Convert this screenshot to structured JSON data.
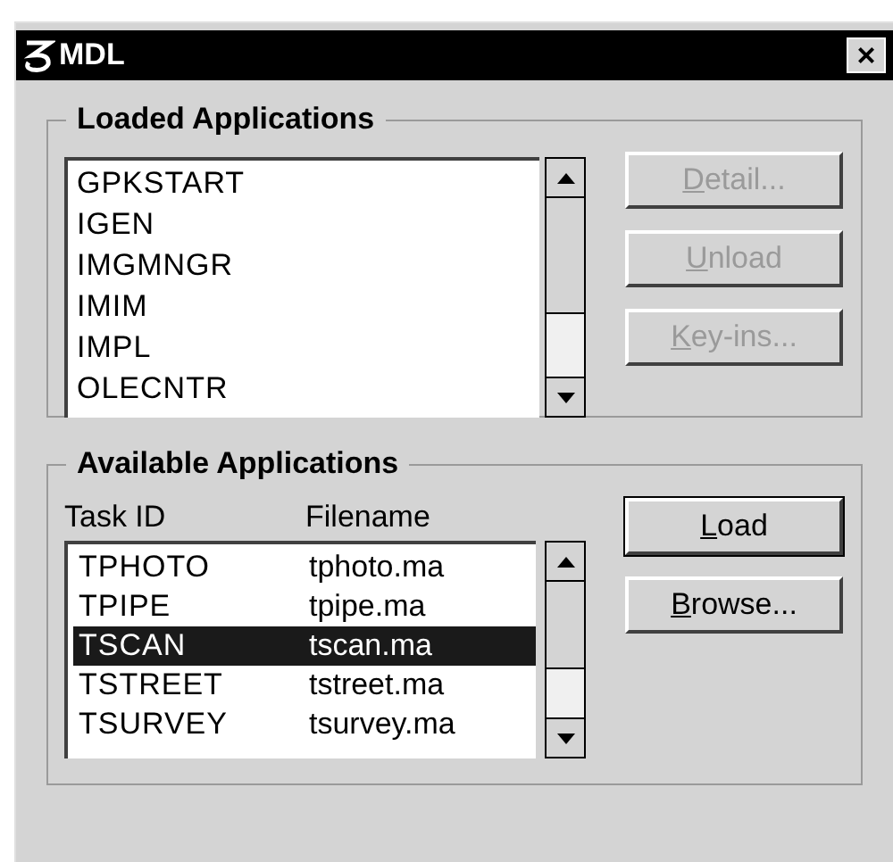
{
  "window": {
    "title": "MDL",
    "close": "×"
  },
  "loaded": {
    "title": "Loaded Applications",
    "items": [
      {
        "label": "GPKSTART",
        "selected": false
      },
      {
        "label": "IGEN",
        "selected": false
      },
      {
        "label": "IMGMNGR",
        "selected": false
      },
      {
        "label": "IMIM",
        "selected": false
      },
      {
        "label": "IMPL",
        "selected": false
      },
      {
        "label": "OLECNTR",
        "selected": false
      }
    ],
    "buttons": [
      {
        "label": "Detail...",
        "disabled": true,
        "default": false
      },
      {
        "label": "Unload",
        "disabled": true,
        "default": false
      },
      {
        "label": "Key-ins...",
        "disabled": true,
        "default": false
      }
    ]
  },
  "available": {
    "title": "Available Applications",
    "columns": [
      "Task ID",
      "Filename"
    ],
    "rows": [
      {
        "task_id": "TPHOTO",
        "filename": "tphoto.ma",
        "selected": false
      },
      {
        "task_id": "TPIPE",
        "filename": "tpipe.ma",
        "selected": false
      },
      {
        "task_id": "TSCAN",
        "filename": "tscan.ma",
        "selected": true
      },
      {
        "task_id": "TSTREET",
        "filename": "tstreet.ma",
        "selected": false
      },
      {
        "task_id": "TSURVEY",
        "filename": "tsurvey.ma",
        "selected": false
      }
    ],
    "buttons": [
      {
        "label": "Load",
        "disabled": false,
        "default": true
      },
      {
        "label": "Browse...",
        "disabled": false,
        "default": false
      }
    ]
  }
}
